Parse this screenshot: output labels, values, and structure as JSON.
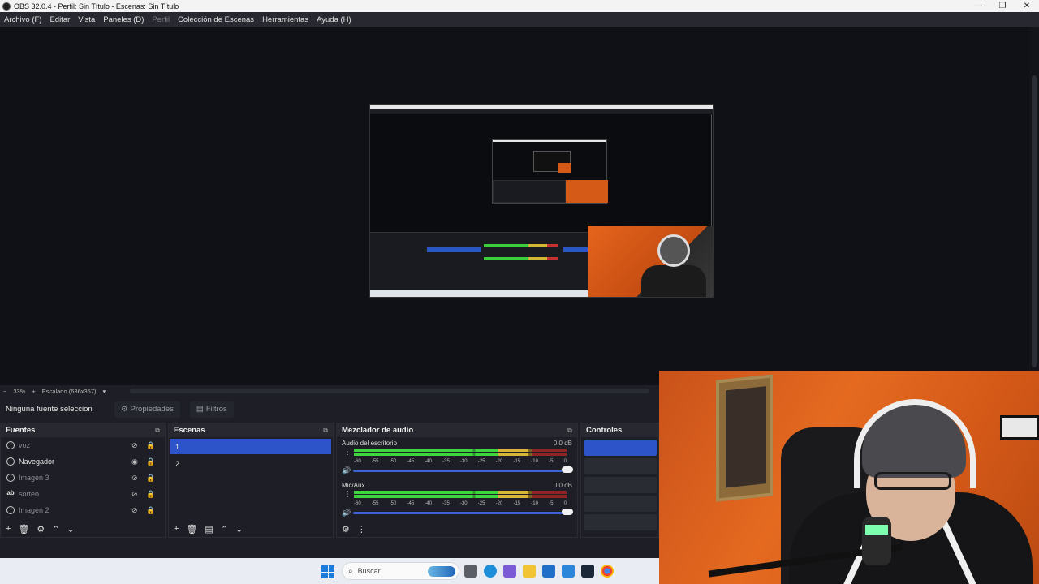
{
  "window": {
    "title": "OBS 32.0.4 - Perfil: Sin Título - Escenas: Sin Título",
    "minimize": "—",
    "maximize": "❐",
    "close": "✕"
  },
  "menu": {
    "items": [
      "Archivo (F)",
      "Editar",
      "Vista",
      "Paneles (D)",
      "Perfil",
      "Colección de Escenas",
      "Herramientas",
      "Ayuda (H)"
    ],
    "disabled": [
      "Perfil"
    ]
  },
  "scale": {
    "minus": "−",
    "zoom": "33%",
    "plus": "+",
    "mode": "Escalado (636x357)"
  },
  "source_toolbar": {
    "no_selection": "Ninguna fuente seleccionada",
    "properties": "Propiedades",
    "filters": "Filtros"
  },
  "sources": {
    "title": "Fuentes",
    "items": [
      {
        "name": "voz",
        "icon": "audio-icon",
        "visible": false
      },
      {
        "name": "Navegador",
        "icon": "browser-icon",
        "visible": true
      },
      {
        "name": "Imagen 3",
        "icon": "image-icon",
        "visible": false
      },
      {
        "name": "sorteo",
        "icon": "text-icon",
        "visible": false
      },
      {
        "name": "Imagen 2",
        "icon": "image-icon",
        "visible": false
      }
    ]
  },
  "scenes": {
    "title": "Escenas",
    "items": [
      "1",
      "2"
    ],
    "selected": "1"
  },
  "mixer": {
    "title": "Mezclador de audio",
    "channels": [
      {
        "name": "Audio del escritorio",
        "db": "0.0 dB",
        "volume": 1.0
      },
      {
        "name": "Mic/Aux",
        "db": "0.0 dB",
        "volume": 1.0
      }
    ],
    "ticks": [
      "-60",
      "-55",
      "-50",
      "-45",
      "-40",
      "-35",
      "-30",
      "-25",
      "-20",
      "-15",
      "-10",
      "-5",
      "0"
    ]
  },
  "controls": {
    "title": "Controles"
  },
  "taskbar": {
    "search_placeholder": "Buscar"
  },
  "colors": {
    "accent": "#2d55c9",
    "meter_green": "#3fd53f",
    "meter_yellow": "#d8b437",
    "meter_red": "#8f2424"
  }
}
